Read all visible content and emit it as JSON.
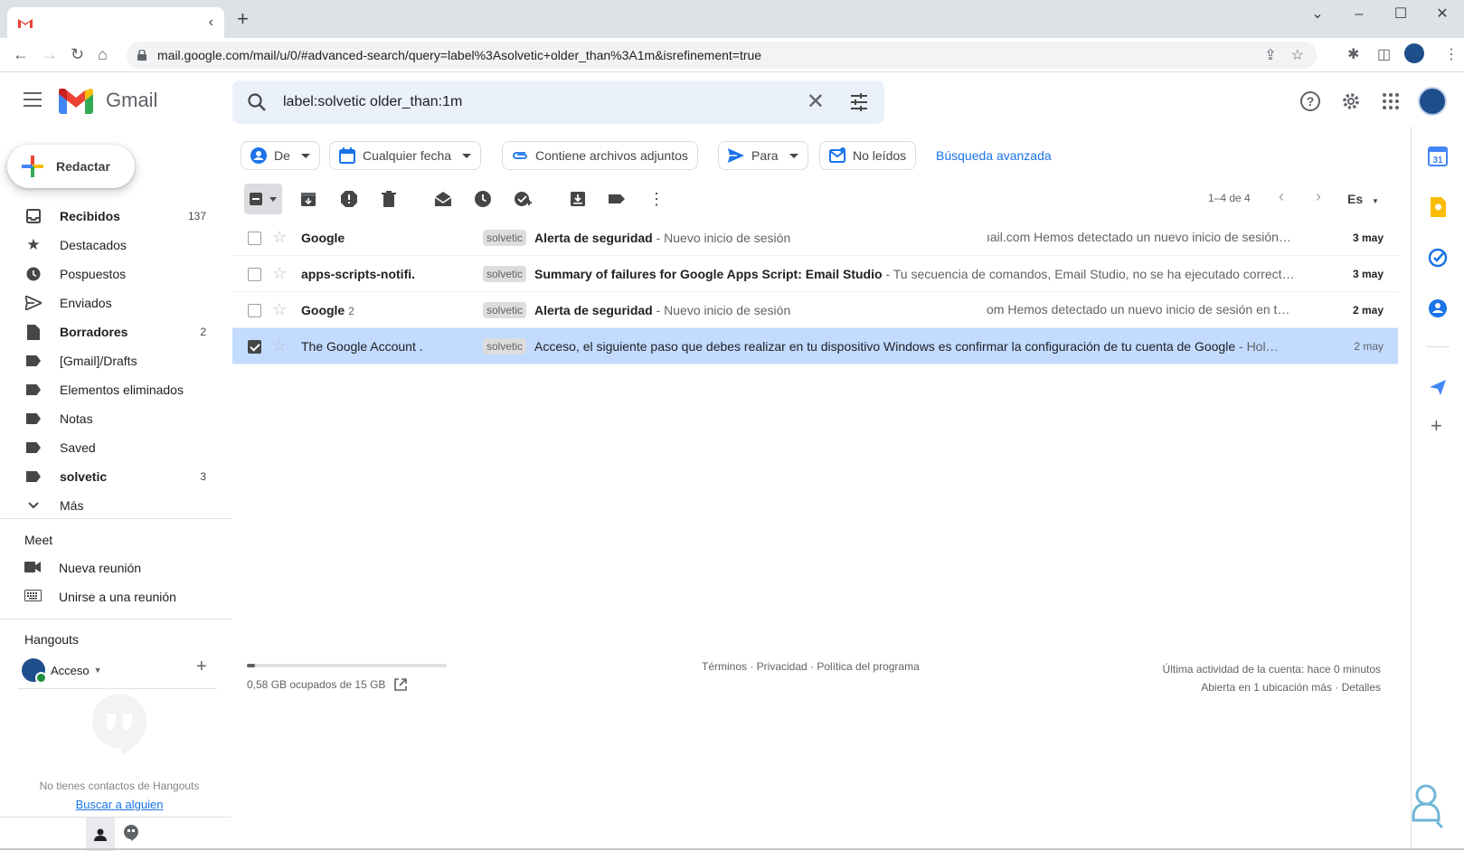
{
  "browser": {
    "tab_title": "",
    "url": "mail.google.com/mail/u/0/#advanced-search/query=label%3Asolvetic+older_than%3A1m&isrefinement=true"
  },
  "header": {
    "brand": "Gmail",
    "search_value": "label:solvetic older_than:1m"
  },
  "compose_label": "Redactar",
  "nav": {
    "items": [
      {
        "label": "Recibidos",
        "count": "137",
        "icon": "inbox-icon",
        "bold": true
      },
      {
        "label": "Destacados",
        "count": "",
        "icon": "star-icon",
        "bold": false
      },
      {
        "label": "Pospuestos",
        "count": "",
        "icon": "clock-icon",
        "bold": false
      },
      {
        "label": "Enviados",
        "count": "",
        "icon": "send-icon",
        "bold": false
      },
      {
        "label": "Borradores",
        "count": "2",
        "icon": "draft-icon",
        "bold": true
      },
      {
        "label": "[Gmail]/Drafts",
        "count": "",
        "icon": "label-icon",
        "bold": false
      },
      {
        "label": "Elementos eliminados",
        "count": "",
        "icon": "label-icon",
        "bold": false
      },
      {
        "label": "Notas",
        "count": "",
        "icon": "label-icon",
        "bold": false
      },
      {
        "label": "Saved",
        "count": "",
        "icon": "label-icon",
        "bold": false
      },
      {
        "label": "solvetic",
        "count": "3",
        "icon": "label-icon",
        "bold": true
      },
      {
        "label": "Más",
        "count": "",
        "icon": "chevron-down-icon",
        "bold": false
      }
    ]
  },
  "meet": {
    "title": "Meet",
    "new_meeting": "Nueva reunión",
    "join_meeting": "Unirse a una reunión"
  },
  "hangouts": {
    "title": "Hangouts",
    "user": "Acceso",
    "empty_text": "No tienes contactos de Hangouts",
    "find_link": "Buscar a alguien"
  },
  "filters": {
    "from": "De",
    "date": "Cualquier fecha",
    "attachments": "Contiene archivos adjuntos",
    "to": "Para",
    "unread": "No leídos",
    "advanced": "Búsqueda avanzada"
  },
  "toolbar": {
    "pager": "1–4 de 4",
    "lang": "Es"
  },
  "messages": [
    {
      "sender": "Google",
      "count": "",
      "tag": "solvetic",
      "subject": "Alerta de seguridad",
      "snippet": " - Nuevo inicio de sesión en",
      "snippet2": "ıail.com Hemos detectado un nuevo inicio de sesión…",
      "date": "3 may",
      "unread": true,
      "selected": false
    },
    {
      "sender": "apps-scripts-notifi.",
      "count": "",
      "tag": "solvetic",
      "subject": "Summary of failures for Google Apps Script: Email Studio",
      "snippet": " - Tu secuencia de comandos, Email Studio, no se ha ejecutado correcta…",
      "snippet2": "",
      "date": "3 may",
      "unread": true,
      "selected": false
    },
    {
      "sender": "Google",
      "count": "2",
      "tag": "solvetic",
      "subject": "Alerta de seguridad",
      "snippet": " - Nuevo inicio de sesión en",
      "snippet2": "om Hemos detectado un nuevo inicio de sesión en t…",
      "date": "2 may",
      "unread": true,
      "selected": false
    },
    {
      "sender": "The Google Account .",
      "count": "",
      "tag": "solvetic",
      "subject": "Acceso, el siguiente paso que debes realizar en tu dispositivo Windows es confirmar la configuración de tu cuenta de Google",
      "snippet": " - Hol…",
      "snippet2": "",
      "date": "2 may",
      "unread": false,
      "selected": true
    }
  ],
  "footer": {
    "storage": "0,58 GB ocupados de 15 GB",
    "storage_fraction": 0.039,
    "links": "Términos · Privacidad · Política del programa",
    "activity": "Última actividad de la cuenta: hace 0 minutos",
    "sessions": "Abierta en 1 ubicación más · Detalles"
  },
  "colors": {
    "accent": "#1a73e8",
    "selected_row": "#c2dbff",
    "search_bg": "#eaf1fb"
  }
}
